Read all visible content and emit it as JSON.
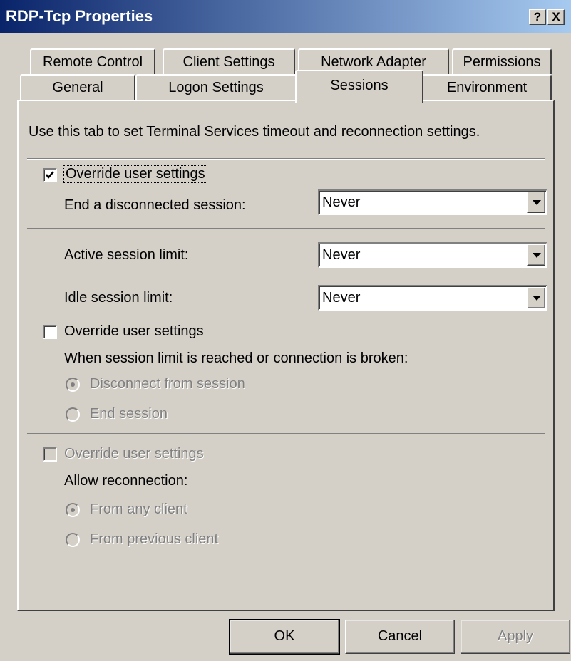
{
  "window": {
    "title": "RDP-Tcp Properties",
    "help_label": "?",
    "close_label": "X"
  },
  "tabs": {
    "row1": [
      "Remote Control",
      "Client Settings",
      "Network Adapter",
      "Permissions"
    ],
    "row2": [
      "General",
      "Logon Settings",
      "Sessions",
      "Environment"
    ],
    "active": "Sessions"
  },
  "sessions": {
    "description": "Use this tab to set Terminal Services timeout and reconnection settings.",
    "group1": {
      "override_label": "Override user settings",
      "override_checked": true,
      "end_disconnected_label": "End a disconnected session:",
      "end_disconnected_value": "Never"
    },
    "limits": {
      "active_label": "Active session limit:",
      "active_value": "Never",
      "idle_label": "Idle session limit:",
      "idle_value": "Never"
    },
    "group2": {
      "override_label": "Override user settings",
      "override_checked": false,
      "when_label": "When session limit is reached or connection is broken:",
      "disconnect_label": "Disconnect from session",
      "disconnect_selected": true,
      "end_session_label": "End session",
      "end_session_selected": false
    },
    "group3": {
      "override_label": "Override user settings",
      "override_checked": false,
      "allow_label": "Allow reconnection:",
      "any_client_label": "From any client",
      "any_client_selected": true,
      "previous_client_label": "From previous client",
      "previous_client_selected": false
    }
  },
  "buttons": {
    "ok": "OK",
    "cancel": "Cancel",
    "apply": "Apply"
  }
}
